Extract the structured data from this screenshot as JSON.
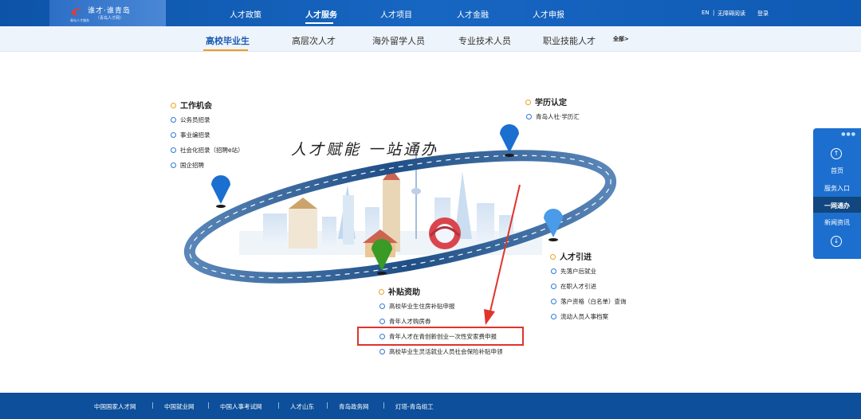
{
  "header": {
    "logo_text": "谁才·谁青岛",
    "logo_sub": "（青岛人才网）",
    "logo_sub2": "青岛人才服务",
    "nav": [
      "人才政策",
      "人才服务",
      "人才项目",
      "人才金融",
      "人才申报"
    ],
    "lang": "EN",
    "accessibility": "无障碍阅读",
    "login": "登录",
    "separator": "|"
  },
  "subnav": {
    "items": [
      "高校毕业生",
      "高层次人才",
      "海外留学人员",
      "专业技术人员",
      "职业技能人才"
    ],
    "all": "全部>"
  },
  "slogan": "人才赋能  一站通办",
  "groups": {
    "work": {
      "title": "工作机会",
      "items": [
        "公务员招录",
        "事业编招录",
        "社会化招录（招聘e站）",
        "国企招聘"
      ]
    },
    "education": {
      "title": "学历认定",
      "items": [
        "青岛人社·学历汇"
      ]
    },
    "introduce": {
      "title": "人才引进",
      "items": [
        "先落户后就业",
        "在职人才引进",
        "落户资格（白名单）查询",
        "流动人员人事档案"
      ]
    },
    "subsidy": {
      "title": "补贴资助",
      "items": [
        "高校毕业生住房补贴申报",
        "青年人才购房券",
        "青年人才在青创新创业一次性安家费申报",
        "高校毕业生灵活就业人员社会保险补贴申领"
      ]
    }
  },
  "float_panel": {
    "dots": "●●●",
    "up_icon": "arrow-up",
    "down_icon": "arrow-down",
    "items": [
      "首页",
      "服务入口",
      "一网通办",
      "新闻资讯"
    ]
  },
  "footer": {
    "links": [
      "中国国家人才网",
      "中国就业网",
      "中国人事考试网",
      "人才山东",
      "青岛政务网",
      "灯塔-青岛组工"
    ],
    "separator": "|"
  },
  "colors": {
    "primary": "#1766c2",
    "accent": "#f29a21",
    "highlight": "#e0332c",
    "pin_blue": "#1a6fd0",
    "pin_green": "#3a9a26"
  }
}
